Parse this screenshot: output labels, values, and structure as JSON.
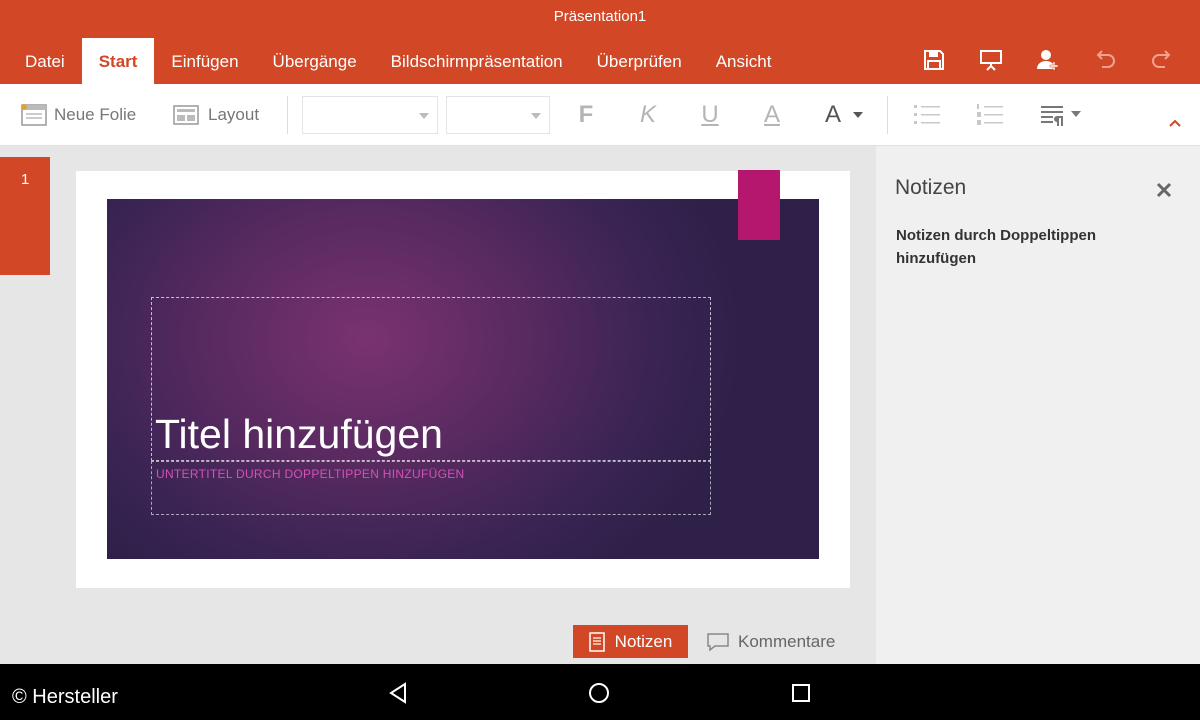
{
  "window": {
    "title": "Präsentation1"
  },
  "tabs": [
    {
      "label": "Datei"
    },
    {
      "label": "Start"
    },
    {
      "label": "Einfügen"
    },
    {
      "label": "Übergänge"
    },
    {
      "label": "Bildschirmpräsentation"
    },
    {
      "label": "Überprüfen"
    },
    {
      "label": "Ansicht"
    }
  ],
  "active_tab": "Start",
  "toolbar_icons": [
    "save-icon",
    "present-icon",
    "share-icon",
    "undo-icon",
    "redo-icon"
  ],
  "ribbon": {
    "new_slide_label": "Neue Folie",
    "layout_label": "Layout",
    "font_name": "",
    "font_size": "",
    "bold_glyph": "F",
    "italic_glyph": "K",
    "underline_glyph": "U",
    "highlight_glyph": "A",
    "font_color_glyph": "A"
  },
  "thumbnails": [
    {
      "number": "1",
      "selected": true
    }
  ],
  "slide": {
    "title_placeholder": "Titel hinzufügen",
    "subtitle_placeholder": "UNTERTITEL DURCH DOPPELTIPPEN HINZUFÜGEN"
  },
  "bottom": {
    "notes_label": "Notizen",
    "comments_label": "Kommentare"
  },
  "notes_pane": {
    "title": "Notizen",
    "hint": "Notizen durch Doppeltippen hinzufügen"
  },
  "credit": "© Hersteller",
  "colors": {
    "brand": "#d24726",
    "accent": "#b5176e",
    "subtitle": "#d451b6"
  }
}
